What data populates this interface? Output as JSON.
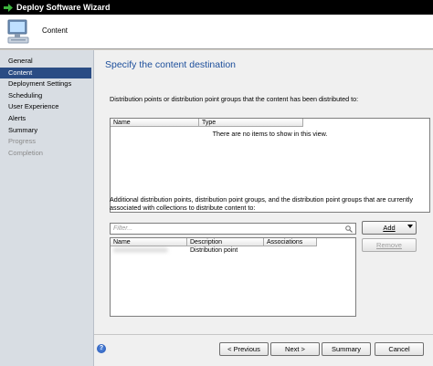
{
  "window": {
    "title": "Deploy Software Wizard"
  },
  "header": {
    "title": "Content"
  },
  "sidebar": {
    "items": [
      {
        "label": "General",
        "state": "normal"
      },
      {
        "label": "Content",
        "state": "active"
      },
      {
        "label": "Deployment Settings",
        "state": "normal"
      },
      {
        "label": "Scheduling",
        "state": "normal"
      },
      {
        "label": "User Experience",
        "state": "normal"
      },
      {
        "label": "Alerts",
        "state": "normal"
      },
      {
        "label": "Summary",
        "state": "normal"
      },
      {
        "label": "Progress",
        "state": "disabled"
      },
      {
        "label": "Completion",
        "state": "disabled"
      }
    ]
  },
  "main": {
    "title": "Specify the content destination",
    "distributed_label": "Distribution points or distribution point groups that the content has been distributed to:",
    "distributed_table": {
      "columns": [
        "Name",
        "Type"
      ],
      "empty_message": "There are no items to show in this view."
    },
    "additional_label_line1": "Additional distribution points, distribution point groups, and the distribution point groups that are currently",
    "additional_label_line2": "associated with collections to distribute content to:",
    "filter": {
      "placeholder": "Filter..."
    },
    "add_button": "Add",
    "remove_button": "Remove",
    "additional_table": {
      "columns": [
        "Name",
        "Description",
        "Associations"
      ],
      "rows": [
        {
          "name": "xxxxxxxxxxxxxxxxx",
          "description": "Distribution point",
          "associations": ""
        }
      ]
    }
  },
  "footer": {
    "previous": "< Previous",
    "next": "Next >",
    "summary": "Summary",
    "cancel": "Cancel"
  },
  "colors": {
    "accent_title": "#1c4e9b",
    "sidebar_active": "#2a4c84",
    "sidebar_bg": "#d8dde3"
  }
}
